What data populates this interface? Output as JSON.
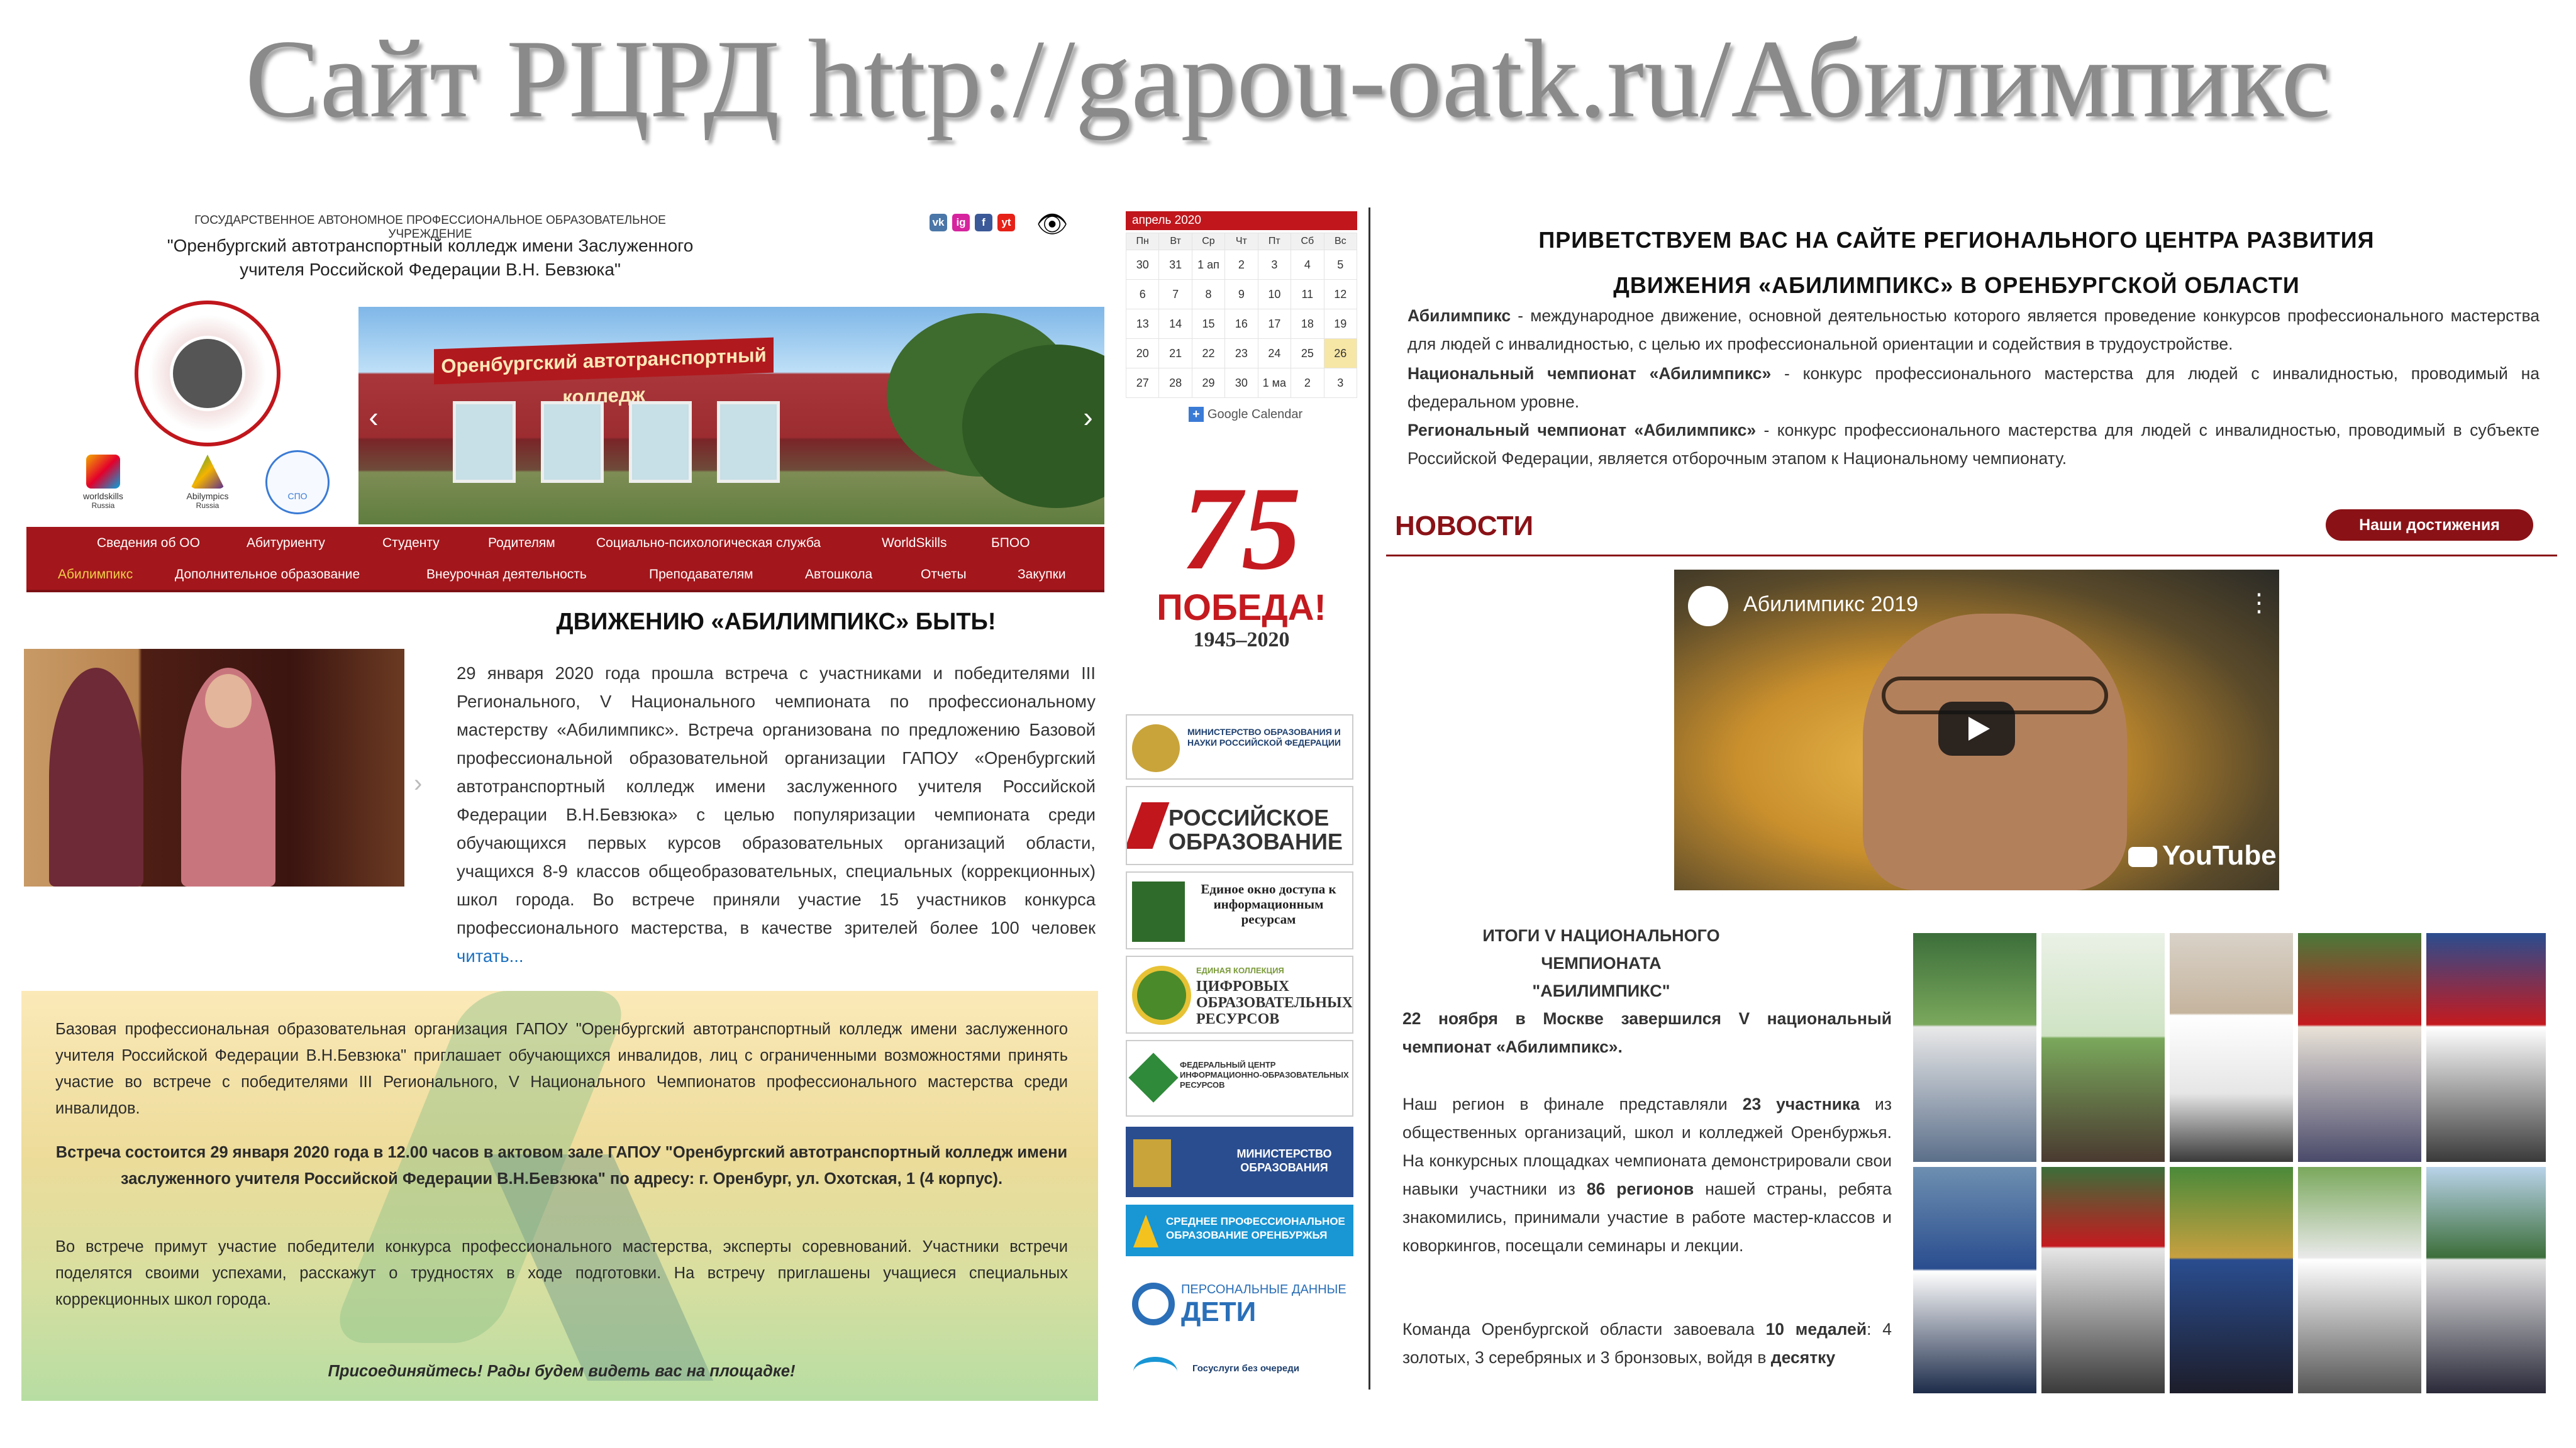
{
  "slide": {
    "title": "Сайт РЦРД http://gapou-oatk.ru/Абилимпикс"
  },
  "left_site": {
    "gov_line": "ГОСУДАРСТВЕННОЕ АВТОНОМНОЕ ПРОФЕССИОНАЛЬНОЕ ОБРАЗОВАТЕЛЬНОЕ УЧРЕЖДЕНИЕ",
    "college_name_1": "\"Оренбургский автотранспортный колледж имени Заслуженного",
    "college_name_2": "учителя Российской Федерации В.Н. Бевзюка\"",
    "social": [
      "vk",
      "ig",
      "f",
      "yt"
    ],
    "logos": {
      "worldskills": "worldskills",
      "worldskills_sub": "Russia",
      "abilympics": "Abilympics",
      "abilympics_sub": "Russia",
      "spo": "СПО"
    },
    "building_sign": "Оренбургский автотранспортный колледж",
    "nav_row1": [
      "Сведения об ОО",
      "Абитуриенту",
      "Студенту",
      "Родителям",
      "Социально-психологическая служба",
      "WorldSkills",
      "БПОО"
    ],
    "nav_row2": [
      "Абилимпикс",
      "Дополнительное образование",
      "Внеурочная деятельность",
      "Преподавателям",
      "Автошкола",
      "Отчеты",
      "Закупки"
    ],
    "article": {
      "title": "ДВИЖЕНИЮ «АБИЛИМПИКС» БЫТЬ!",
      "text": "29 января 2020 года прошла встреча с участниками и победителями III Регионального, V Национального чемпионата по профессиональному мастерству «Абилимпикс». Встреча организована по предложению Базовой профессиональной образовательной организации ГАПОУ «Оренбургский автотранспортный колледж имени заслуженного учителя Российской Федерации В.Н.Бевзюка» с целью популяризации чемпионата среди обучающихся первых курсов образовательных организаций области, учащихся 8-9 классов общеобразовательных, специальных (коррекционных) школ города. Во встрече приняли участие 15 участников конкурса профессионального мастерства, в качестве зрителей более 100 человек",
      "read_more": "читать..."
    },
    "announcement": {
      "p1": "Базовая профессиональная образовательная организация ГАПОУ \"Оренбургский автотранспортный колледж имени заслуженного учителя Российской Федерации В.Н.Бевзюка\" приглашает обучающихся инвалидов, лиц с ограниченными возможностями принять участие во встрече с победителями III Регионального, V Национального Чемпионатов профессионального мастерства среди инвалидов.",
      "p2": "Встреча состоится 29 января 2020 года в 12.00 часов в актовом зале ГАПОУ \"Оренбургский автотранспортный колледж имени заслуженного учителя Российской Федерации В.Н.Бевзюка\" по адресу: г. Оренбург, ул. Охотская, 1 (4 корпус).",
      "p3": "Во встрече примут участие победители конкурса профессионального мастерства, эксперты соревнований. Участники встречи поделятся своими успехами, расскажут о трудностях в ходе подготовки. На встречу приглашены учащиеся специальных коррекционных школ города.",
      "p4": "Присоединяйтесь! Рады будем видеть вас на площадке!"
    }
  },
  "sidebar": {
    "calendar_month": "апрель 2020",
    "weekdays": [
      "Пн",
      "Вт",
      "Ср",
      "Чт",
      "Пт",
      "Сб",
      "Вс"
    ],
    "weeks": [
      [
        "30",
        "31",
        "1 ап",
        "2",
        "3",
        "4",
        "5"
      ],
      [
        "6",
        "7",
        "8",
        "9",
        "10",
        "11",
        "12"
      ],
      [
        "13",
        "14",
        "15",
        "16",
        "17",
        "18",
        "19"
      ],
      [
        "20",
        "21",
        "22",
        "23",
        "24",
        "25",
        "26"
      ],
      [
        "27",
        "28",
        "29",
        "30",
        "1 ма",
        "2",
        "3"
      ]
    ],
    "google_calendar": "Google Calendar",
    "pobeda": {
      "number": "75",
      "word": "ПОБЕДА!",
      "years": "1945–2020"
    },
    "banners": {
      "minobr": "МИНИСТЕРСТВО ОБРАЗОВАНИЯ И НАУКИ РОССИЙСКОЙ ФЕДЕРАЦИИ",
      "rossobr_1": "РОССИЙСКОЕ",
      "rossobr_2": "ОБРАЗОВАНИЕ",
      "window": "Единое окно доступа к информационным ресурсам",
      "cor_1": "ЕДИНАЯ КОЛЛЕКЦИЯ",
      "cor_2": "ЦИФРОВЫХ ОБРАЗОВАТЕЛЬНЫХ РЕСУРСОВ",
      "fcior": "ФЕДЕРАЛЬНЫЙ ЦЕНТР ИНФОРМАЦИОННО-ОБРАЗОВАТЕЛЬНЫХ РЕСУРСОВ",
      "minobr_orb": "МИНИСТЕРСТВО ОБРАЗОВАНИЯ",
      "spo_orb": "СРЕДНЕЕ ПРОФЕССИОНАЛЬНОЕ ОБРАЗОВАНИЕ ОРЕНБУРЖЬЯ",
      "pd_1": "ПЕРСОНАЛЬНЫЕ ДАННЫЕ",
      "pd_2": "ДЕТИ",
      "gosuslugi": "Госуслуги без очереди"
    }
  },
  "right_site": {
    "welcome_1": "ПРИВЕТСТВУЕМ ВАС НА САЙТЕ РЕГИОНАЛЬНОГО ЦЕНТРА РАЗВИТИЯ",
    "welcome_2": "ДВИЖЕНИЯ «АБИЛИМПИКС» В ОРЕНБУРГСКОЙ ОБЛАСТИ",
    "intro_1_b": "Абилимпикс",
    "intro_1": " - международное движение, основной деятельностью которого является проведение конкурсов профессионального мастерства для людей с инвалидностью, с целью их профессиональной ориентации и содействия в трудоустройстве.",
    "intro_2_b": "Национальный чемпионат «Абилимпикс»",
    "intro_2": " - конкурс профессионального мастерства для людей с инвалидностью, проводимый на федеральном уровне.",
    "intro_3_b": "Региональный чемпионат «Абилимпикс»",
    "intro_3": " - конкурс профессионального мастерства для людей с инвалидностью, проводимый в субъекте Российской Федерации, является отборочным этапом к Национальному чемпионату.",
    "news_title": "НОВОСТИ",
    "achievements_button": "Наши достижения",
    "video_title": "Абилимпикс 2019",
    "youtube": "YouTube",
    "results_title_1": "ИТОГИ V НАЦИОНАЛЬНОГО ЧЕМПИОНАТА",
    "results_title_2": "\"АБИЛИМПИКС\"",
    "results_p1_b": "22 ноября в Москве завершился V национальный чемпионат «Абилимпикс».",
    "results_p2_a": "Наш регион в финале представляли ",
    "results_p2_b1": "23 участника",
    "results_p2_c": " из общественных организаций, школ и колледжей Оренбуржья. На конкурсных площадках чемпионата демонстрировали свои навыки участники из ",
    "results_p2_b2": "86 регионов",
    "results_p2_d": " нашей страны, ребята знакомились, принимали участие в работе мастер-классов и коворкингов, посещали семинары и лекции.",
    "results_p3_a": "Команда Оренбургской области завоевала ",
    "results_p3_b": "10 медалей",
    "results_p3_c": ": 4 золотых, 3 серебряных и 3 бронзовых, войдя в ",
    "results_p3_d": "десятку"
  },
  "colors": {
    "brand_red": "#a3161b",
    "dark_red": "#8a1217",
    "active_nav": "#f2cf4a",
    "link": "#1a6fc0"
  }
}
